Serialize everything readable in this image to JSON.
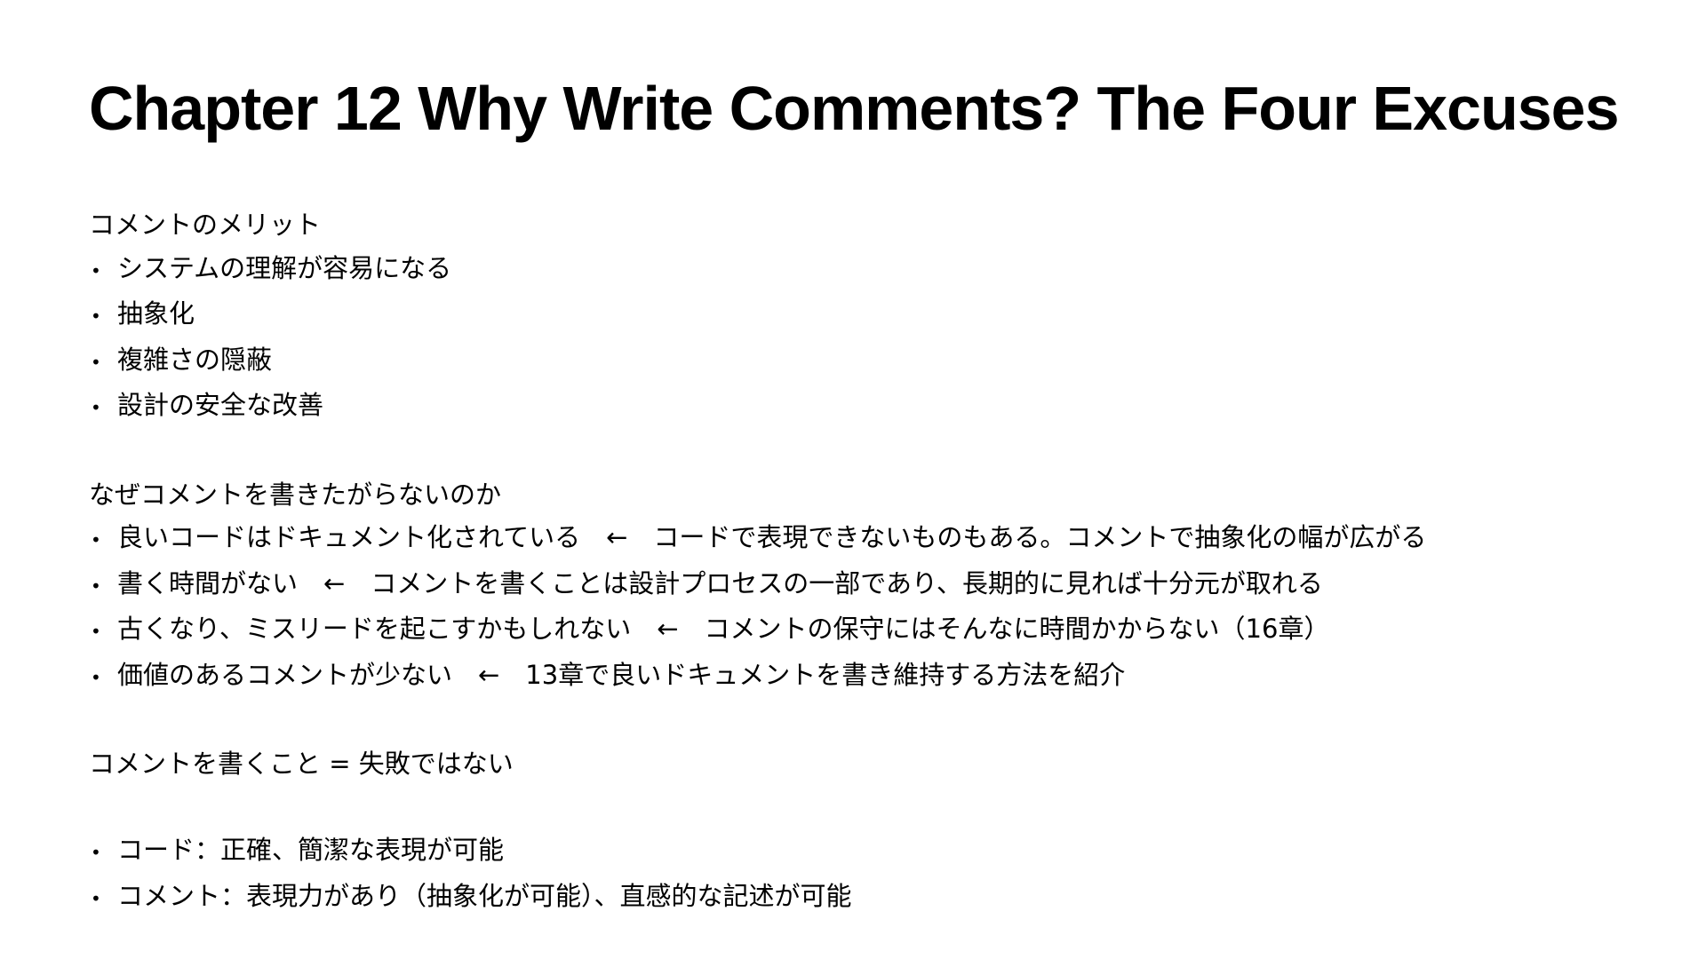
{
  "title": "Chapter 12 Why Write Comments? The Four Excuses",
  "bullet_symbol": "•",
  "section1": {
    "heading": "コメントのメリット",
    "items": [
      "システムの理解が容易になる",
      "抽象化",
      "複雑さの隠蔽",
      "設計の安全な改善"
    ]
  },
  "section2": {
    "heading": "なぜコメントを書きたがらないのか",
    "items": [
      "良いコードはドキュメント化されている　←　コードで表現できないものもある。コメントで抽象化の幅が広がる",
      "書く時間がない　←　コメントを書くことは設計プロセスの一部であり、長期的に見れば十分元が取れる",
      "古くなり、ミスリードを起こすかもしれない　←　コメントの保守にはそんなに時間かからない（16章）",
      "価値のあるコメントが少ない　←　13章で良いドキュメントを書き維持する方法を紹介"
    ]
  },
  "section3": {
    "heading": "コメントを書くこと = 失敗ではない"
  },
  "section4": {
    "items": [
      "コード：正確、簡潔な表現が可能",
      "コメント：表現力があり（抽象化が可能）、直感的な記述が可能"
    ]
  }
}
